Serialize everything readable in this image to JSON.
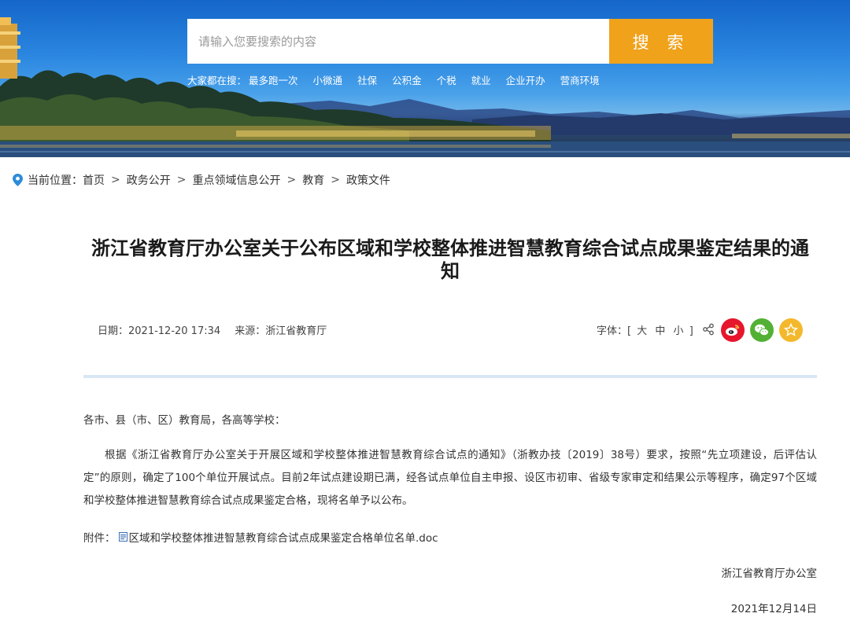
{
  "search": {
    "placeholder": "请输入您要搜索的内容",
    "button_label": "搜 索"
  },
  "hot_searches": {
    "label": "大家都在搜：",
    "items": [
      "最多跑一次",
      "小微通",
      "社保",
      "公积金",
      "个税",
      "就业",
      "企业开办",
      "营商环境"
    ]
  },
  "breadcrumb": {
    "prefix": "当前位置：",
    "items": [
      "首页",
      "政务公开",
      "重点领域信息公开",
      "教育",
      "政策文件"
    ],
    "separator": ">"
  },
  "article": {
    "title": "浙江省教育厅办公室关于公布区域和学校整体推进智慧教育综合试点成果鉴定结果的通知",
    "date": "日期：2021-12-20 17:34",
    "source": "来源：浙江省教育厅",
    "font_label": "字体：[",
    "font_sizes": [
      "大",
      "中",
      "小"
    ],
    "font_close": "]",
    "salutation": "各市、县（市、区）教育局，各高等学校：",
    "paragraph": "根据《浙江省教育厅办公室关于开展区域和学校整体推进智慧教育综合试点的通知》（浙教办技〔2019〕38号）要求，按照“先立项建设，后评估认定”的原则，确定了100个单位开展试点。目前2年试点建设期已满，经各试点单位自主申报、设区市初审、省级专家审定和结果公示等程序，确定97个区域和学校整体推进智慧教育综合试点成果鉴定合格，现将名单予以公布。",
    "attachment_label": "附件：",
    "attachment_file": "区域和学校整体推进智慧教育综合试点成果鉴定合格单位名单.doc",
    "signature": "浙江省教育厅办公室",
    "sign_date": "2021年12月14日"
  },
  "share": {
    "icons": [
      "share-icon",
      "weibo-icon",
      "wechat-icon",
      "favorite-icon"
    ],
    "colors": {
      "weibo": "#e6162d",
      "wechat": "#52b135",
      "favorite": "#f3b82c"
    }
  },
  "colors": {
    "search_button": "#f0a21b",
    "divider": "#d9e7f5",
    "pin": "#2e8bd8"
  }
}
